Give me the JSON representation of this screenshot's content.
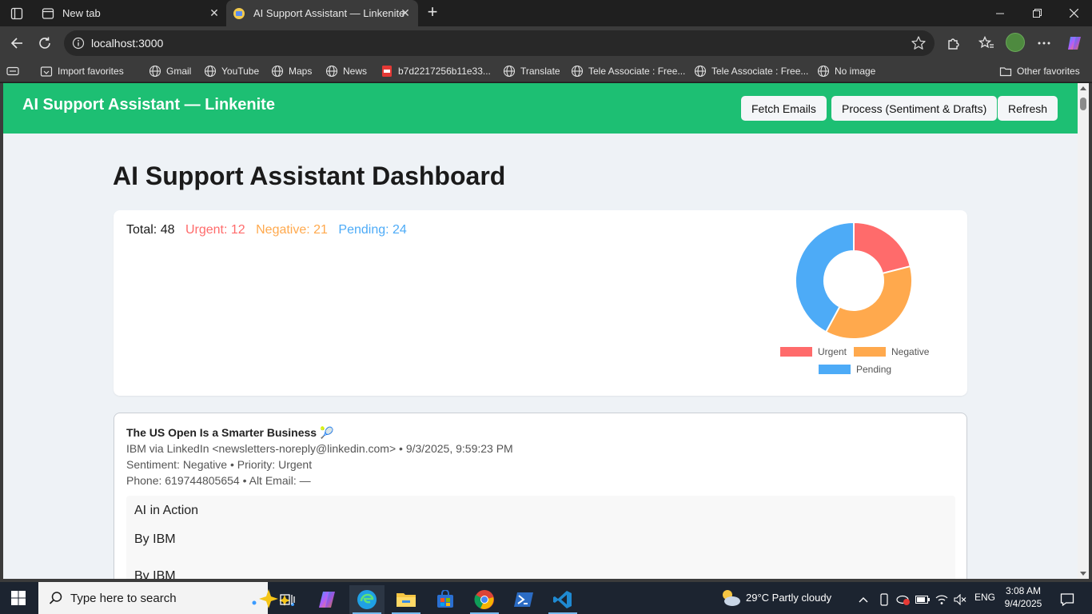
{
  "browser": {
    "tabs": [
      {
        "label": "New tab"
      },
      {
        "label": "AI Support Assistant — Linkenite"
      }
    ],
    "address": "localhost:3000"
  },
  "favorites": [
    {
      "label": "Import favorites",
      "icon": "import-icon"
    },
    {
      "label": "Gmail",
      "icon": "globe-icon"
    },
    {
      "label": "YouTube",
      "icon": "globe-icon"
    },
    {
      "label": "Maps",
      "icon": "globe-icon"
    },
    {
      "label": "News",
      "icon": "globe-icon"
    },
    {
      "label": "b7d2217256b11e33...",
      "icon": "pdf-icon"
    },
    {
      "label": "Translate",
      "icon": "globe-icon"
    },
    {
      "label": "Tele Associate : Free...",
      "icon": "globe-icon"
    },
    {
      "label": "Tele Associate : Free...",
      "icon": "globe-icon"
    },
    {
      "label": "No image",
      "icon": "globe-icon"
    },
    {
      "label": "Other favorites",
      "icon": "folder-icon"
    }
  ],
  "app": {
    "title": "AI Support Assistant — Linkenite",
    "buttons": {
      "fetch": "Fetch Emails",
      "process": "Process (Sentiment & Drafts)",
      "refresh": "Refresh"
    },
    "dashboard_title": "AI Support Assistant Dashboard",
    "stats": {
      "total": "Total: 48",
      "urgent": "Urgent: 12",
      "negative": "Negative: 21",
      "pending": "Pending: 24"
    },
    "colors": {
      "header": "#1dbf73",
      "urgent": "#ff6b6b",
      "negative": "#ffa94d",
      "pending": "#4dabf7"
    }
  },
  "chart_data": {
    "type": "pie",
    "variant": "doughnut",
    "categories": [
      "Urgent",
      "Negative",
      "Pending"
    ],
    "values": [
      12,
      21,
      24
    ],
    "colors": [
      "#ff6b6b",
      "#ffa94d",
      "#4dabf7"
    ],
    "legend": "bottom"
  },
  "email": {
    "subject": "The US Open Is a Smarter Business 🎾",
    "from_line": "IBM via LinkedIn <newsletters-noreply@linkedin.com> • 9/3/2025, 9:59:23 PM",
    "meta_line": "Sentiment: Negative • Priority: Urgent",
    "contact_line": "Phone: 619744805654 • Alt Email: —",
    "body": [
      "AI in Action",
      "By IBM",
      "By IBM"
    ]
  },
  "taskbar": {
    "search_placeholder": "Type here to search",
    "weather": "29°C  Partly cloudy",
    "language": "ENG",
    "time": "3:08 AM",
    "date": "9/4/2025"
  }
}
